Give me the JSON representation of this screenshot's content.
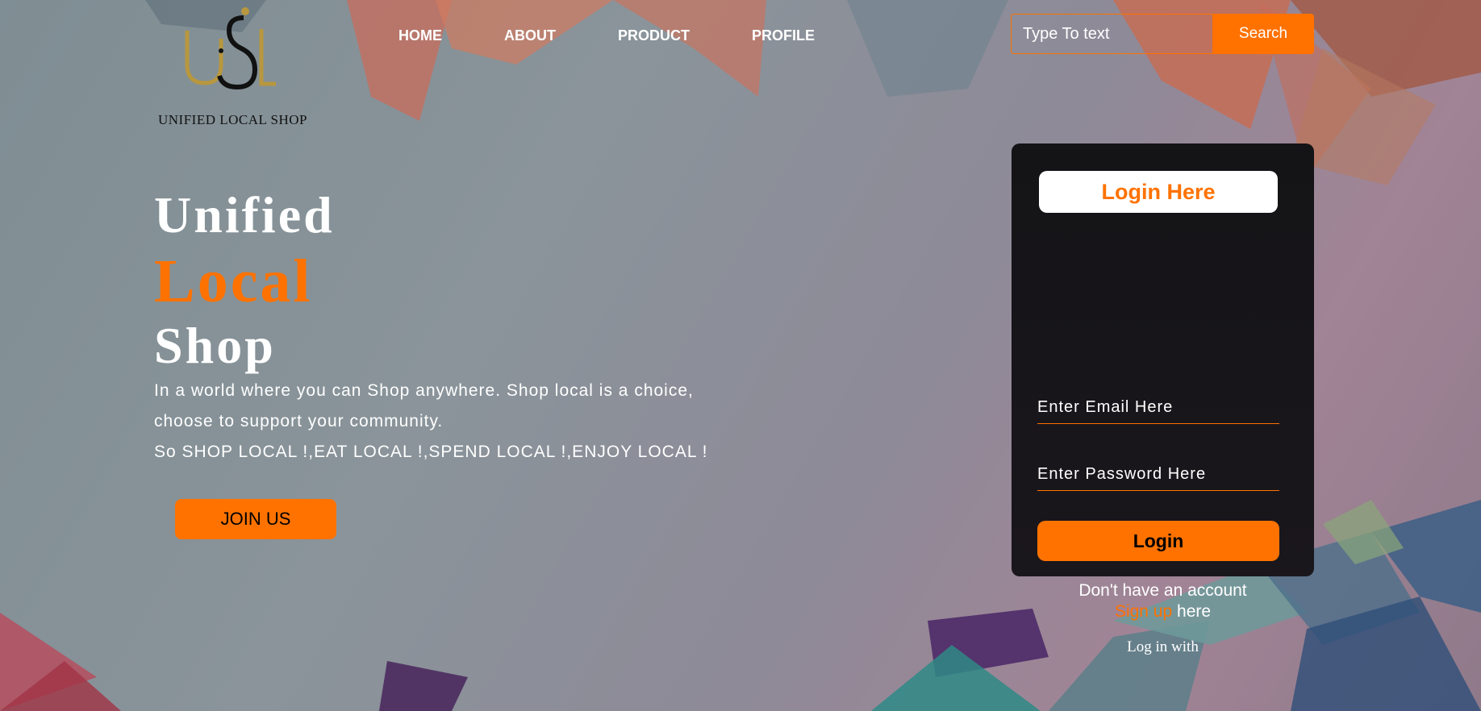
{
  "nav": {
    "brand": "UNIFIED LOCAL SHOP",
    "logo_letters": "USL",
    "items": [
      {
        "label": "HOME"
      },
      {
        "label": "ABOUT"
      },
      {
        "label": "PRODUCT"
      },
      {
        "label": "PROFILE"
      }
    ]
  },
  "search": {
    "placeholder": "Type To text",
    "button_label": "Search"
  },
  "hero": {
    "line1": "Unified",
    "line2": "Local",
    "line3": "Shop",
    "paragraph1": "In a world where you can Shop anywhere. Shop local is a choice, choose to support your community.",
    "paragraph2": "So SHOP LOCAL !,EAT LOCAL !,SPEND LOCAL !,ENJOY LOCAL !",
    "join_label": "JOIN US"
  },
  "login": {
    "title": "Login Here",
    "email_placeholder": "Enter Email Here",
    "password_placeholder": "Enter Password Here",
    "button_label": "Login",
    "no_account": "Don't have an account",
    "signup_link": "Sign up",
    "signup_suffix": "here",
    "log_in_with": "Log in with"
  },
  "colors": {
    "accent": "#ff7200",
    "form_bg": "#141316",
    "logo_gold": "#b8973e"
  }
}
